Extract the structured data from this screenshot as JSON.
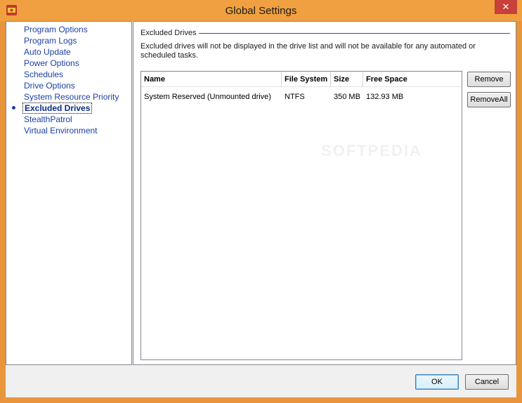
{
  "window": {
    "title": "Global Settings",
    "close_glyph": "✕"
  },
  "sidebar": {
    "items": [
      {
        "label": "Program Options"
      },
      {
        "label": "Program Logs"
      },
      {
        "label": "Auto Update"
      },
      {
        "label": "Power Options"
      },
      {
        "label": "Schedules"
      },
      {
        "label": "Drive Options"
      },
      {
        "label": "System Resource Priority"
      },
      {
        "label": "Excluded Drives",
        "selected": true
      },
      {
        "label": "StealthPatrol"
      },
      {
        "label": "Virtual Environment"
      }
    ]
  },
  "main": {
    "group_title": "Excluded Drives",
    "description": "Excluded drives will not be displayed in the drive list and will not be available for any automated or scheduled tasks.",
    "table": {
      "columns": [
        "Name",
        "File System",
        "Size",
        "Free Space"
      ],
      "rows": [
        [
          "System Reserved (Unmounted drive)",
          "NTFS",
          "350 MB",
          "132.93 MB"
        ]
      ]
    },
    "remove_label": "Remove",
    "remove_all_label": "RemoveAll"
  },
  "footer": {
    "ok_label": "OK",
    "cancel_label": "Cancel"
  },
  "watermark": "SOFTPEDIA",
  "colors": {
    "titlebar": "#f0a040",
    "frame": "#e8953c",
    "link": "#1c3fa8",
    "close": "#c7403a"
  }
}
